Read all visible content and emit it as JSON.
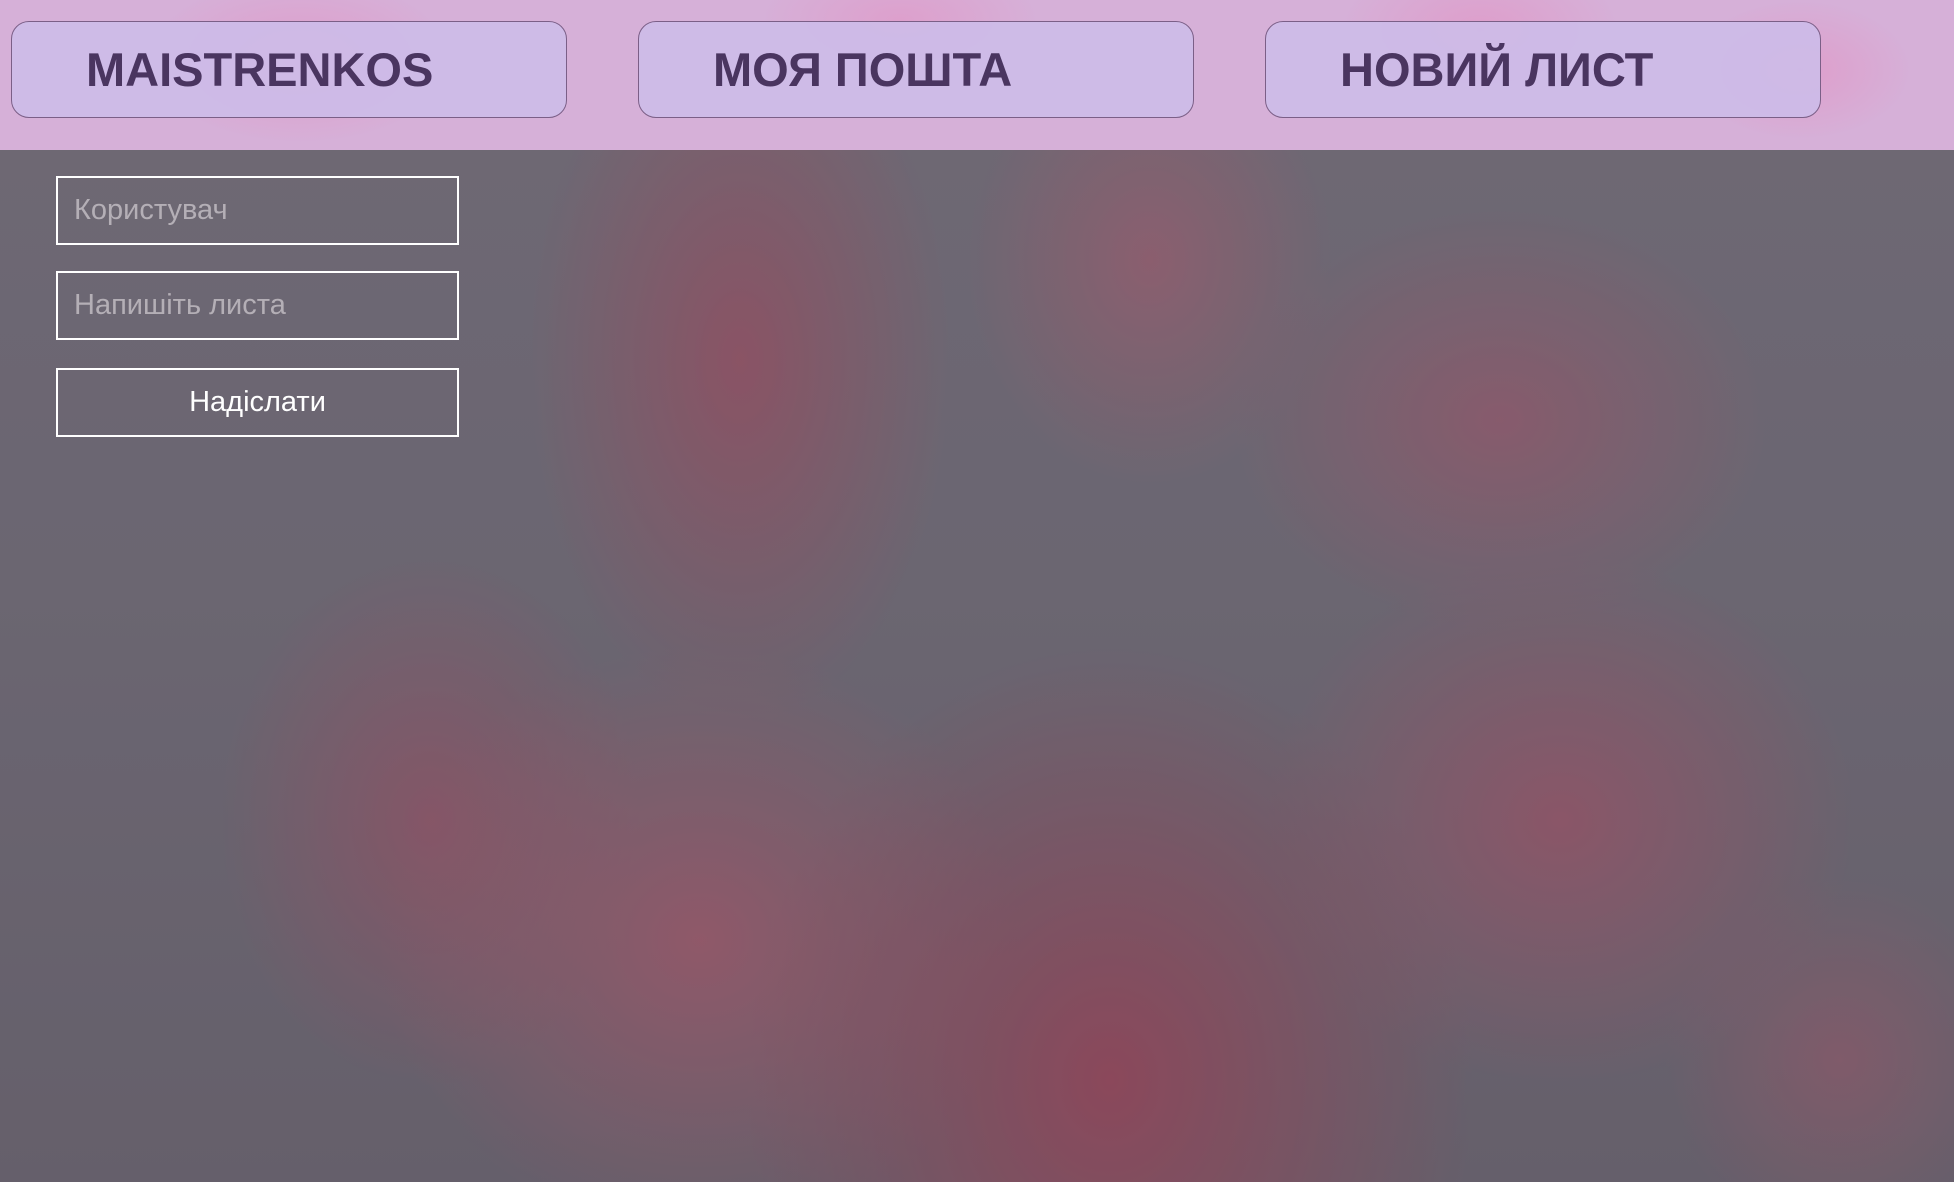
{
  "nav": {
    "brand": "MAISTRENKOS",
    "my_mail": "МОЯ ПОШТА",
    "new_letter": "НОВИЙ ЛИСТ"
  },
  "form": {
    "user_placeholder": "Користувач",
    "user_value": "",
    "message_placeholder": "Напишіть листа",
    "message_value": "",
    "send_label": "Надіслати"
  },
  "colors": {
    "header_background": "#d6b0d8",
    "nav_button_background": "#cdbce8",
    "nav_button_text": "#4a3560",
    "form_border": "#ffffff",
    "form_text": "#ffffff"
  }
}
